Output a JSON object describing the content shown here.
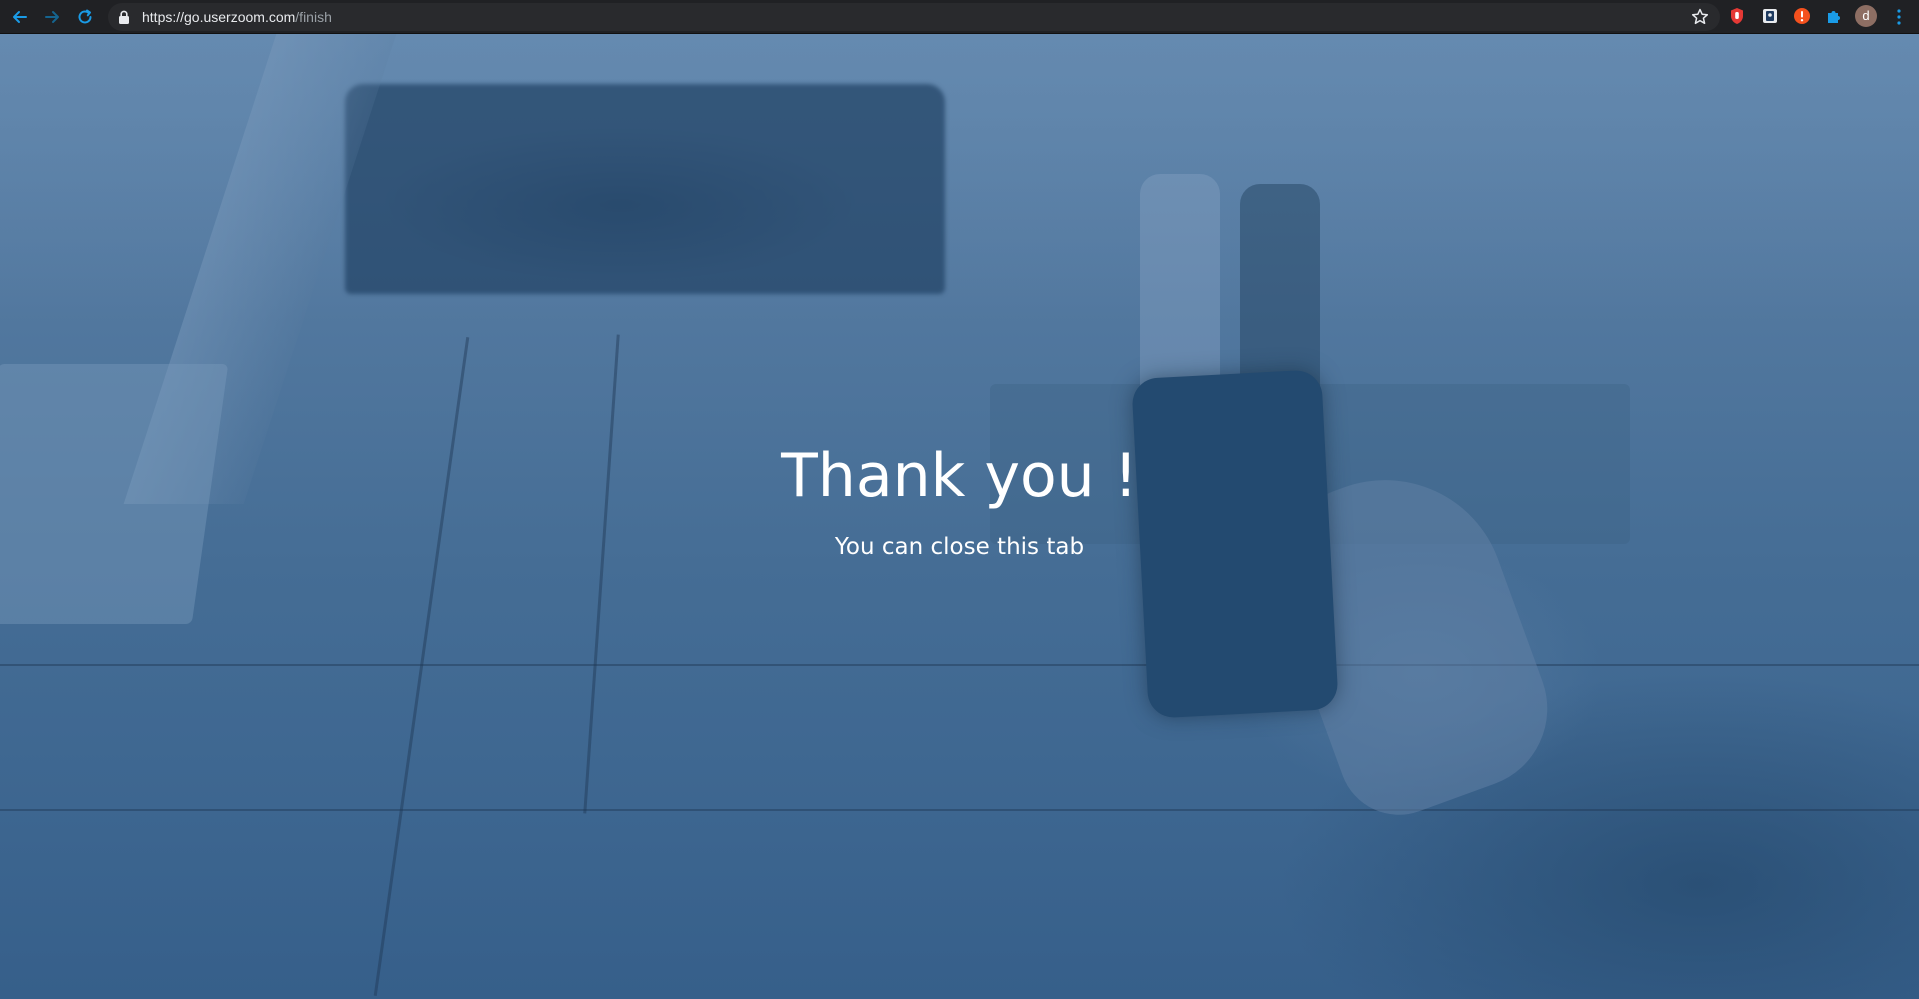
{
  "browser": {
    "url_host": "https://go.userzoom.com",
    "url_path": "/finish",
    "profile_initial": "d",
    "icons": {
      "back": "arrow-left-icon",
      "forward": "arrow-right-icon",
      "reload": "reload-icon",
      "lock": "lock-icon",
      "bookmark": "star-icon",
      "extensions": [
        "red-hand-extension-icon",
        "blue-square-extension-icon",
        "orange-alert-extension-icon",
        "puzzle-icon"
      ],
      "menu": "kebab-menu-icon"
    },
    "colors": {
      "toolbar": "#202124",
      "omnibox": "#292a2d",
      "accent": "#1a9be6"
    }
  },
  "page": {
    "title": "Thank you !",
    "subtitle": "You can close this tab",
    "background_tint": "#4a7199"
  }
}
